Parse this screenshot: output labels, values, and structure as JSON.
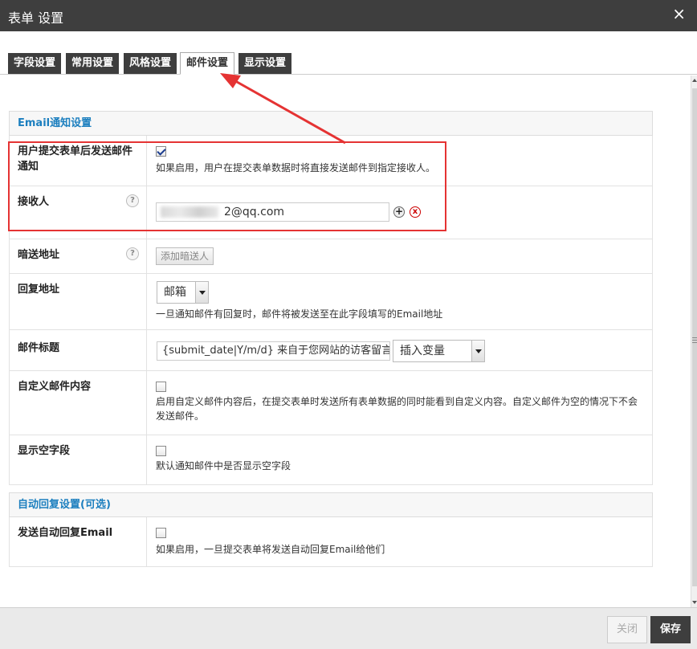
{
  "window": {
    "title": "表单 设置",
    "close_glyph": "×"
  },
  "tabs": [
    {
      "label": "字段设置"
    },
    {
      "label": "常用设置"
    },
    {
      "label": "风格设置"
    },
    {
      "label": "邮件设置",
      "active": true
    },
    {
      "label": "显示设置"
    }
  ],
  "email_section": {
    "title": "Email通知设置",
    "notify": {
      "label": "用户提交表单后发送邮件通知",
      "checked": true,
      "desc": "如果启用，用户在提交表单数据时将直接发送邮件到指定接收人。"
    },
    "recipient": {
      "label": "接收人",
      "help": "?",
      "value": "2@qq.com",
      "add": "+",
      "remove": "x"
    },
    "bcc": {
      "label": "暗送地址",
      "help": "?",
      "button": "添加暗送人"
    },
    "reply": {
      "label": "回复地址",
      "select": "邮箱",
      "desc": "一旦通知邮件有回复时，邮件将被发送至在此字段填写的Email地址"
    },
    "subject": {
      "label": "邮件标题",
      "value": "{submit_date|Y/m/d} 来自于您网站的访客留言",
      "insert_var": "插入变量"
    },
    "custom_content": {
      "label": "自定义邮件内容",
      "checked": false,
      "desc": "启用自定义邮件内容后，在提交表单时发送所有表单数据的同时能看到自定义内容。自定义邮件为空的情况下不会发送邮件。"
    },
    "show_empty": {
      "label": "显示空字段",
      "checked": false,
      "desc": "默认通知邮件中是否显示空字段"
    }
  },
  "auto_reply_section": {
    "title": "自动回复设置(可选)",
    "send_auto": {
      "label": "发送自动回复Email",
      "checked": false,
      "desc": "如果启用，一旦提交表单将发送自动回复Email给他们"
    }
  },
  "footer": {
    "close_label": "关闭",
    "save_label": "保存"
  },
  "colors": {
    "titlebar": "#3e3e3e",
    "accent_link": "#1c7fbf",
    "highlight": "#e53333"
  }
}
